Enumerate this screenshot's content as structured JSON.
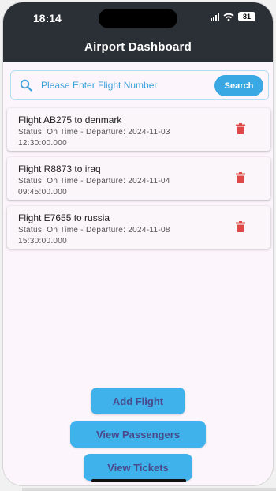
{
  "status_bar": {
    "time": "18:14",
    "battery": "81"
  },
  "app": {
    "title": "Airport Dashboard"
  },
  "search": {
    "placeholder": "Please Enter Flight Number",
    "value": "",
    "button_label": "Search"
  },
  "flights": [
    {
      "title": "Flight AB275 to denmark",
      "status": "Status: On Time - Departure: 2024-11-03 12:30:00.000"
    },
    {
      "title": "Flight R8873 to iraq",
      "status": "Status: On Time - Departure: 2024-11-04 09:45:00.000"
    },
    {
      "title": "Flight E7655 to russia",
      "status": "Status: On Time - Departure: 2024-11-08 15:30:00.000"
    }
  ],
  "actions": {
    "add_flight": "Add Flight",
    "view_passengers": "View Passengers",
    "view_tickets": "View Tickets"
  },
  "colors": {
    "appbar": "#2a3035",
    "accent": "#3aa8e2",
    "delete": "#e04848",
    "background": "#fcf5fb"
  },
  "icons": {
    "search": "search-icon",
    "delete": "trash-icon",
    "wifi": "wifi-icon",
    "signal": "signal-icon",
    "battery": "battery-icon"
  }
}
